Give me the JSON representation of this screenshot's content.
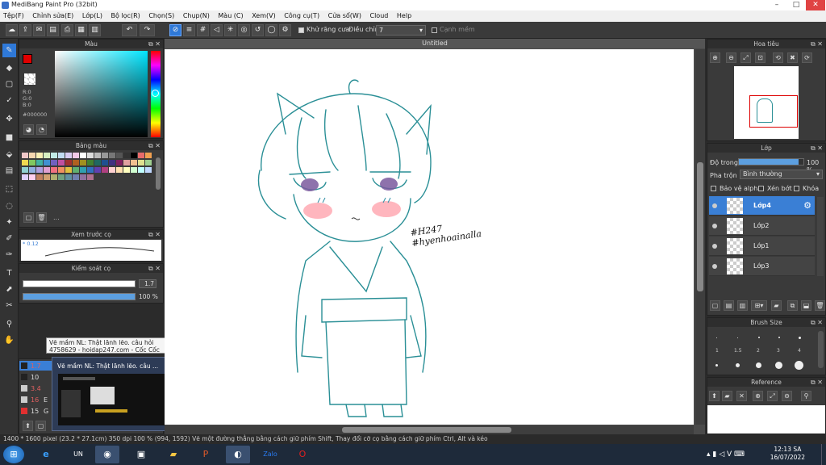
{
  "window": {
    "title": "MediBang Paint Pro (32bit)"
  },
  "menu": [
    "Tệp(F)",
    "Chỉnh sửa(E)",
    "Lớp(L)",
    "Bộ lọc(R)",
    "Chọn(S)",
    "Chụp(N)",
    "Màu (C)",
    "Xem(V)",
    "Công cụ(T)",
    "Cửa sổ(W)",
    "Cloud",
    "Help"
  ],
  "toolbar": {
    "antialias_label": "Khử răng cưa",
    "adjust_label": "Điều chỉnh",
    "adjust_value": "7",
    "snap_label": "Cạnh mềm"
  },
  "color_panel": {
    "title": "Màu",
    "r": "R:0",
    "g": "G:0",
    "b": "B:0",
    "hex": "#000000",
    "primary_color": "#e00000"
  },
  "palette_panel": {
    "title": "Bảng màu",
    "more": "..."
  },
  "brush_preview_panel": {
    "title": "Xem trước cọ",
    "size_text": "* 0.12"
  },
  "brush_control_panel": {
    "title": "Kiểm soát cọ",
    "size_value": "1.7",
    "opacity_value": "100 %"
  },
  "brush_list": [
    {
      "size": "1.7",
      "label": "Pen"
    },
    {
      "size": "10",
      "label": "Pen"
    },
    {
      "size": "3.4",
      "label": "Pen"
    },
    {
      "size": "16",
      "label": "E"
    },
    {
      "size": "15",
      "label": "G"
    }
  ],
  "canvas": {
    "title": "Untitled",
    "signature": "#H247 #hyenhoainalla"
  },
  "navigator_panel": {
    "title": "Hoa tiêu"
  },
  "layer_panel": {
    "title": "Lớp",
    "opacity_label": "Độ trong",
    "opacity_value": "100 %",
    "opacity_fraction": 0.93,
    "blend_label": "Pha trộn",
    "blend_value": "Bình thường",
    "protect_alpha": "Bảo vệ alpha",
    "clipping": "Xén bớt",
    "lock": "Khóa",
    "layers": [
      "Lớp4",
      "Lớp2",
      "Lớp1",
      "Lớp3"
    ]
  },
  "brush_size_panel": {
    "title": "Brush Size",
    "sizes": [
      "1",
      "1.5",
      "2",
      "3",
      "4"
    ]
  },
  "reference_panel": {
    "title": "Reference"
  },
  "status_bar": {
    "text": "1400 * 1600 pixel   (23.2 * 27.1cm)   350 dpi   100 %   (994, 1592)   Vẽ một đường thẳng bằng cách giữ phím Shift, Thay đổi cỡ cọ bằng cách giữ phím Ctrl, Alt và kéo"
  },
  "tooltip": {
    "text": "Vẽ mầm NL: Thật lãnh lẽo. câu hỏi 4758629 - hoidap247.com - Cốc Cốc"
  },
  "taskbar_preview": {
    "title": "Vẽ mầm NL: Thật lãnh lẽo. câu ..."
  },
  "clock": {
    "time": "12:13 SA",
    "date": "16/07/2022"
  }
}
